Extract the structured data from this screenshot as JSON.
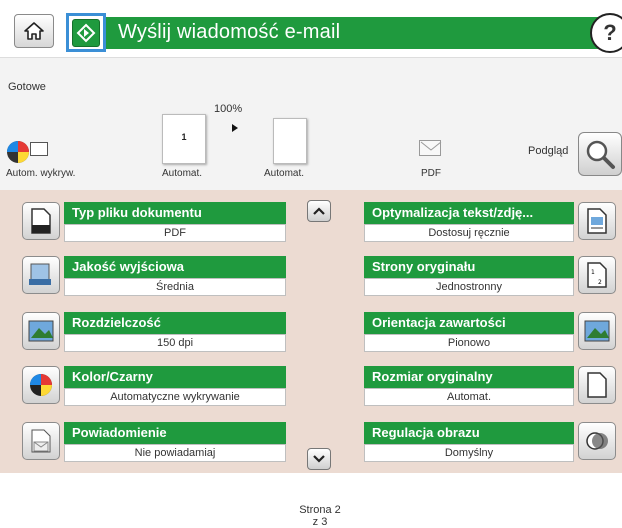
{
  "header": {
    "title": "Wyślij wiadomość e-mail",
    "help_label": "?"
  },
  "status": {
    "state": "Gotowe",
    "zoom": "100%",
    "page_thumb_number": "1",
    "mode_label": "Autom. wykryw.",
    "thumb1_label": "Automat.",
    "thumb2_label": "Automat.",
    "file_type": "PDF",
    "preview_label": "Podgląd"
  },
  "options_left": [
    {
      "title": "Typ pliku dokumentu",
      "value": "PDF",
      "icon": "document-type-icon"
    },
    {
      "title": "Jakość wyjściowa",
      "value": "Średnia",
      "icon": "output-quality-icon"
    },
    {
      "title": "Rozdzielczość",
      "value": "150 dpi",
      "icon": "resolution-icon"
    },
    {
      "title": "Kolor/Czarny",
      "value": "Automatyczne wykrywanie",
      "icon": "color-black-icon"
    },
    {
      "title": "Powiadomienie",
      "value": "Nie powiadamiaj",
      "icon": "notification-icon"
    }
  ],
  "options_right": [
    {
      "title": "Optymalizacja tekst/zdję...",
      "value": "Dostosuj ręcznie",
      "icon": "optimize-text-image-icon"
    },
    {
      "title": "Strony oryginału",
      "value": "Jednostronny",
      "icon": "original-sides-icon"
    },
    {
      "title": "Orientacja zawartości",
      "value": "Pionowo",
      "icon": "content-orientation-icon"
    },
    {
      "title": "Rozmiar oryginalny",
      "value": "Automat.",
      "icon": "original-size-icon"
    },
    {
      "title": "Regulacja obrazu",
      "value": "Domyślny",
      "icon": "image-adjust-icon"
    }
  ],
  "pager": {
    "line1": "Strona 2",
    "line2": "z 3"
  },
  "colors": {
    "accent_green": "#1f9a3e",
    "panel_bg": "#ecdbd2",
    "highlight_blue": "#3b8fd6"
  }
}
